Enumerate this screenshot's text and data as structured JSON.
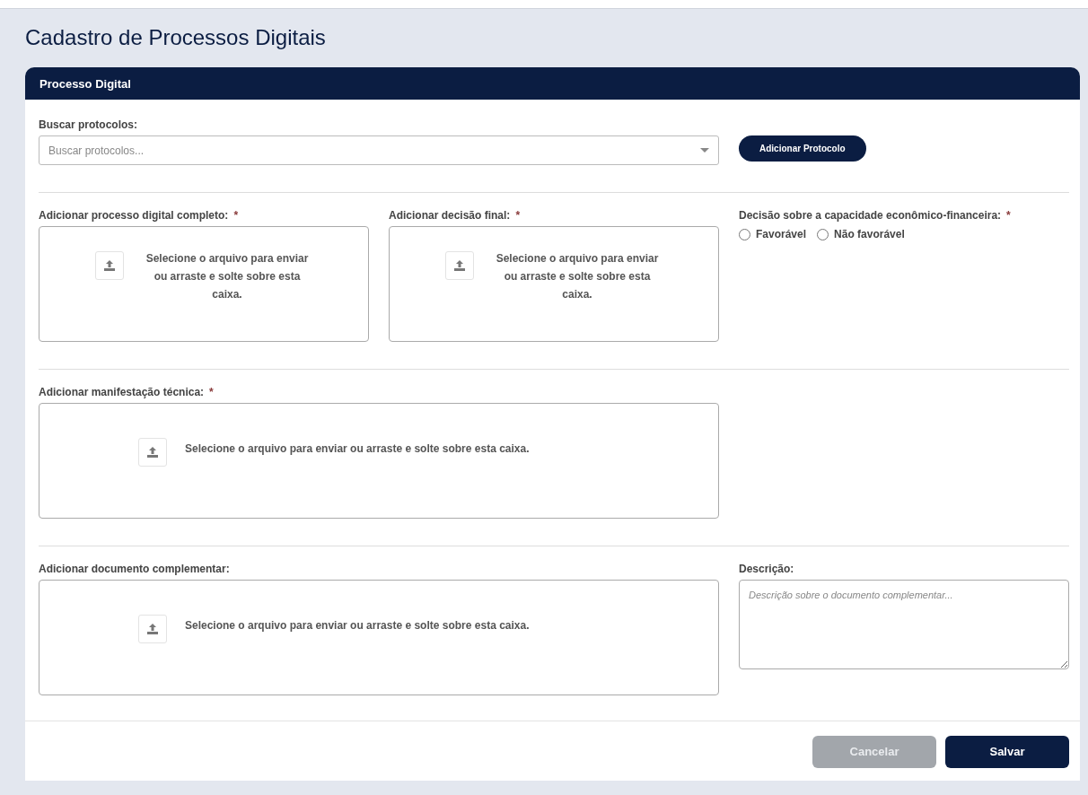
{
  "page_title": "Cadastro de Processos Digitais",
  "card": {
    "title": "Processo Digital"
  },
  "search": {
    "label": "Buscar protocolos:",
    "placeholder": "Buscar protocolos...",
    "button": "Adicionar Protocolo"
  },
  "uploads": [
    {
      "kind": "narrow",
      "label": "Adicionar processo digital completo:",
      "required_mark": "*",
      "text": "Selecione o arquivo para enviar ou arraste e solte sobre esta caixa."
    },
    {
      "kind": "narrow",
      "label": "Adicionar decisão final:",
      "required_mark": "*",
      "text": "Selecione o arquivo para enviar ou arraste e solte sobre esta caixa."
    },
    {
      "kind": "wide",
      "label": "Adicionar manifestação técnica:",
      "required_mark": "*",
      "text": "Selecione o arquivo para enviar ou arraste e solte sobre esta caixa."
    },
    {
      "kind": "wide",
      "label": "Adicionar documento complementar:",
      "text": "Selecione o arquivo para enviar ou arraste e solte sobre esta caixa."
    }
  ],
  "decision": {
    "label": "Decisão sobre a capacidade econômico-financeira:",
    "required_mark": "*",
    "options": [
      {
        "label": "Favorável",
        "selected": false
      },
      {
        "label": "Não favorável",
        "selected": false
      }
    ]
  },
  "description": {
    "label": "Descrição:",
    "placeholder": "Descrição sobre o documento complementar..."
  },
  "buttons": [
    {
      "kind": "secondary",
      "label": "Cancelar"
    },
    {
      "kind": "primary",
      "label": "Salvar"
    }
  ]
}
